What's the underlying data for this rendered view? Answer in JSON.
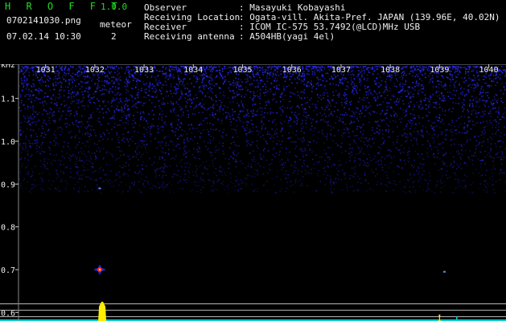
{
  "header": {
    "app_title": "H R O F F T",
    "version": "1.0.0",
    "filename": "0702141030.png",
    "datetime": "07.02.14 10:30",
    "meteor_label": "meteor",
    "meteor_count": "2"
  },
  "info": [
    {
      "label": "Observer",
      "value": ": Masayuki Kobayashi"
    },
    {
      "label": "Receiving Location",
      "value": ": Ogata-vill. Akita-Pref. JAPAN (139.96E, 40.02N)"
    },
    {
      "label": "Receiver",
      "value": ": ICOM IC-575 53.7492(@LCD)MHz USB"
    },
    {
      "label": "Receiving antenna",
      "value": ": A504HB(yagi 4el)"
    }
  ],
  "chart_data": {
    "type": "heatmap",
    "title": "",
    "xlabel": "",
    "ylabel": "kHz",
    "x_ticks": [
      "1031",
      "1032",
      "1033",
      "1034",
      "1035",
      "1036",
      "1037",
      "1038",
      "1039",
      "1040"
    ],
    "y_ticks": [
      "1.1",
      "1.0",
      "0.9",
      "0.8",
      "0.7",
      "0.6"
    ],
    "y_range": [
      0.58,
      1.18
    ],
    "x_range": [
      1030.45,
      1040.35
    ],
    "grid": false,
    "colors": {
      "noise": "#2a2aff",
      "signal_peak": "#ffee00",
      "signal_core": "#ff2020",
      "level_lines": "#bbbbbb"
    },
    "level_lines_khz": [
      0.62,
      0.605,
      0.59
    ],
    "meteor_echoes": [
      {
        "time_min": 1032.1,
        "freq_khz": 0.7
      },
      {
        "time_min": 1032.1,
        "freq_khz": 0.89
      },
      {
        "time_min": 1039.1,
        "freq_khz": 0.695
      }
    ],
    "signal_level_bars": [
      {
        "time_min": 1032.15,
        "level_khz": 0.625,
        "color": "#ffee00"
      },
      {
        "time_min": 1039.0,
        "level_khz": 0.595,
        "color": "#ffee00"
      },
      {
        "time_min": 1039.35,
        "level_khz": 0.59,
        "color": "#00cccc"
      }
    ]
  }
}
